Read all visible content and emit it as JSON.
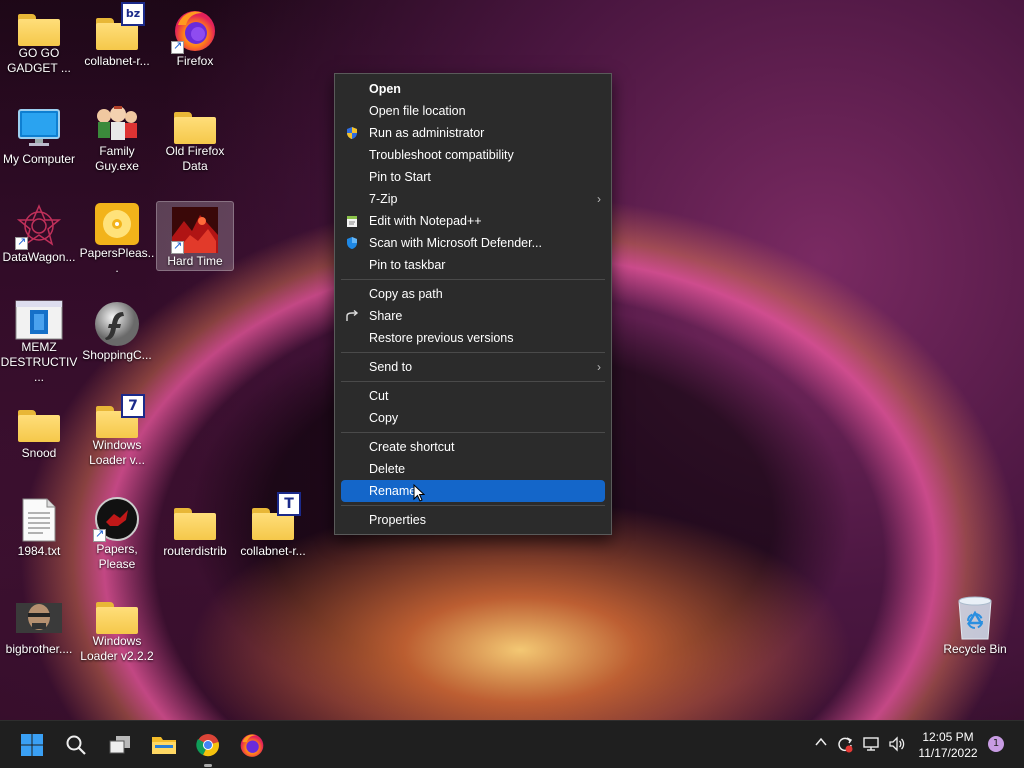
{
  "desktop": {
    "icons": [
      {
        "label": "GO GO GADGET ...",
        "icon": "folder-icon"
      },
      {
        "label": "collabnet-r...",
        "icon": "folder-bz-icon",
        "badge": "bz"
      },
      {
        "label": "Firefox",
        "icon": "firefox-icon"
      },
      {
        "label": "My Computer",
        "icon": "monitor-icon"
      },
      {
        "label": "Family Guy.exe",
        "icon": "family-guy-icon"
      },
      {
        "label": "Old Firefox Data",
        "icon": "folder-icon"
      },
      {
        "label": "DataWagon...",
        "icon": "datawagon-icon"
      },
      {
        "label": "PapersPleas...",
        "icon": "disc-icon"
      },
      {
        "label": "Hard Time",
        "icon": "hard-time-icon"
      },
      {
        "label": "MEMZ DESTRUCTIV...",
        "icon": "memz-icon"
      },
      {
        "label": "ShoppingC...",
        "icon": "flash-icon"
      },
      {
        "label": "Snood",
        "icon": "folder-icon"
      },
      {
        "label": "Windows Loader v...",
        "icon": "folder-7-icon",
        "badge": "7"
      },
      {
        "label": "1984.txt",
        "icon": "text-file-icon"
      },
      {
        "label": "Papers, Please",
        "icon": "papers-please-icon"
      },
      {
        "label": "routerdistrib",
        "icon": "folder-icon"
      },
      {
        "label": "collabnet-r...",
        "icon": "folder-t-icon",
        "badge": "T"
      },
      {
        "label": "bigbrother....",
        "icon": "bigbrother-icon"
      },
      {
        "label": "Windows Loader v2.2.2",
        "icon": "folder-icon"
      },
      {
        "label": "Recycle Bin",
        "icon": "recycle-bin-icon"
      }
    ]
  },
  "context_menu": {
    "items": {
      "open": "Open",
      "open_file_location": "Open file location",
      "run_as_admin": "Run as administrator",
      "troubleshoot": "Troubleshoot compatibility",
      "pin_to_start": "Pin to Start",
      "seven_zip": "7-Zip",
      "edit_notepad": "Edit with Notepad++",
      "scan_defender": "Scan with Microsoft Defender...",
      "pin_to_taskbar": "Pin to taskbar",
      "copy_as_path": "Copy as path",
      "share": "Share",
      "restore_previous": "Restore previous versions",
      "send_to": "Send to",
      "cut": "Cut",
      "copy": "Copy",
      "create_shortcut": "Create shortcut",
      "delete": "Delete",
      "rename": "Rename",
      "properties": "Properties"
    },
    "highlighted": "rename"
  },
  "taskbar": {
    "apps": [
      "start-icon",
      "search-icon",
      "task-view-icon",
      "file-explorer-icon",
      "chrome-icon",
      "firefox-icon"
    ],
    "clock": {
      "time": "12:05 PM",
      "date": "11/17/2022"
    },
    "notification_count": "1"
  },
  "colors": {
    "menu_bg": "#2b2b2b",
    "menu_highlight": "#1466c9",
    "taskbar_bg": "#1f1f1f",
    "folder": "#f5c84a"
  }
}
